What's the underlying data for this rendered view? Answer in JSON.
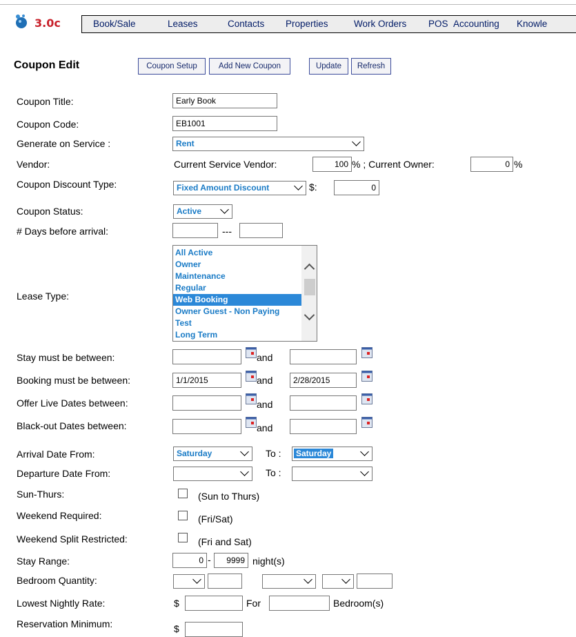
{
  "app": {
    "version": "3.0c"
  },
  "nav": [
    "Book/Sale",
    "Leases",
    "Contacts",
    "Properties",
    "Work Orders",
    "POS",
    "Accounting",
    "Knowle"
  ],
  "page": {
    "title": "Coupon Edit"
  },
  "buttons": {
    "setup": "Coupon Setup",
    "add": "Add New Coupon",
    "update": "Update",
    "refresh": "Refresh"
  },
  "form": {
    "coupon_title": {
      "label": "Coupon Title:",
      "value": "Early Book"
    },
    "coupon_code": {
      "label": "Coupon Code:",
      "value": "EB1001"
    },
    "generate_on_service": {
      "label": "Generate on Service :",
      "value": "Rent"
    },
    "vendor": {
      "label": "Vendor:",
      "service_vendor_label": "Current Service Vendor:",
      "service_vendor_value": "100",
      "pct1": "% ; Current Owner:",
      "owner_value": "0",
      "pct2": "%"
    },
    "discount_type": {
      "label": "Coupon Discount Type:",
      "value": "Fixed Amount Discount",
      "dollar": "$:",
      "amount": "0"
    },
    "status": {
      "label": "Coupon Status:",
      "value": "Active"
    },
    "days_before": {
      "label": "# Days before arrival:",
      "sep": "---"
    },
    "lease_type": {
      "label": "Lease Type:",
      "options": [
        "All Active",
        "Owner",
        "Maintenance",
        "Regular",
        "Web Booking",
        "Owner Guest - Non Paying",
        "Test",
        "Long Term"
      ],
      "selected": "Web Booking"
    },
    "stay_between": {
      "label": "Stay must be between:",
      "and": "and"
    },
    "booking_between": {
      "label": "Booking must be between:",
      "from": "1/1/2015",
      "to": "2/28/2015",
      "and": "and"
    },
    "offer_live": {
      "label": "Offer Live Dates between:",
      "and": "and"
    },
    "blackout": {
      "label": "Black-out Dates between:",
      "and": "and"
    },
    "arrival": {
      "label": "Arrival Date From:",
      "from": "Saturday",
      "to_label": "To :",
      "to": "Saturday"
    },
    "departure": {
      "label": "Departure Date From:",
      "to_label": "To :"
    },
    "sun_thurs": {
      "label": "Sun-Thurs:",
      "note": "(Sun to Thurs)"
    },
    "weekend_required": {
      "label": "Weekend Required:",
      "note": "(Fri/Sat)"
    },
    "weekend_split": {
      "label": "Weekend Split Restricted:",
      "note": "(Fri and Sat)"
    },
    "stay_range": {
      "label": "Stay Range:",
      "min": "0",
      "max": "9999",
      "unit": "night(s)"
    },
    "bedroom_qty": {
      "label": "Bedroom Quantity:"
    },
    "lowest_rate": {
      "label": "Lowest Nightly Rate:",
      "dollar": "$",
      "for": "For",
      "unit": "Bedroom(s)"
    },
    "reservation_min": {
      "label": "Reservation Minimum:",
      "dollar": "$"
    }
  }
}
